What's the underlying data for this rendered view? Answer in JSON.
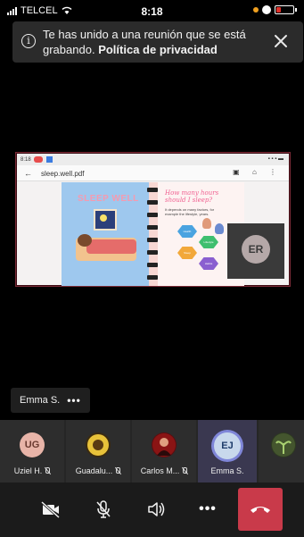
{
  "status_bar": {
    "carrier": "TELCEL",
    "time": "8:18",
    "icons": [
      "signal-icon",
      "wifi-icon",
      "dot-icon",
      "alarm-icon",
      "battery-icon"
    ]
  },
  "banner": {
    "message": "Te has unido a una reunión que se está grabando.",
    "link_text": "Política de privacidad",
    "icons": [
      "info-icon",
      "close-icon"
    ]
  },
  "shared_screen": {
    "pdf_filename": "sleep.well.pdf",
    "mini_status_time": "8:18",
    "page_title": "SLEEP WELL",
    "page_question": "How many hours should I sleep?",
    "page_small_text": "It depends on many factors, for example the lifestyle, years.",
    "hex_labels": [
      "Health",
      "Lifestyle",
      "Sleep",
      "Habits"
    ],
    "presenter_tile_initials": "ER"
  },
  "active_speaker": {
    "name": "Emma S.",
    "more_label": "•••"
  },
  "participants": [
    {
      "initials": "UG",
      "name": "Uziel H.",
      "muted": true,
      "avatar_color": "#e8b4a8",
      "text_color": "#6a3a30",
      "type": "initials"
    },
    {
      "initials": "",
      "name": "Guadalu...",
      "muted": true,
      "avatar_color": "#d9b23a",
      "type": "photo-sunflower"
    },
    {
      "initials": "",
      "name": "Carlos M...",
      "muted": true,
      "avatar_color": "#a81e1e",
      "type": "photo-person"
    },
    {
      "initials": "EJ",
      "name": "Emma S.",
      "muted": false,
      "avatar_color": "#c8d8ec",
      "text_color": "#1f3d6b",
      "type": "initials",
      "active": true
    },
    {
      "initials": "",
      "name": "",
      "muted": false,
      "avatar_color": "#6d8a4a",
      "type": "photo-plant"
    }
  ],
  "controls": {
    "items": [
      "camera-off-icon",
      "mic-off-icon",
      "speaker-icon",
      "more-icon",
      "hang-up-icon"
    ],
    "more_label": "•••",
    "colors": {
      "hangup": "#c93a4a",
      "bar": "#1b1b1b"
    }
  }
}
